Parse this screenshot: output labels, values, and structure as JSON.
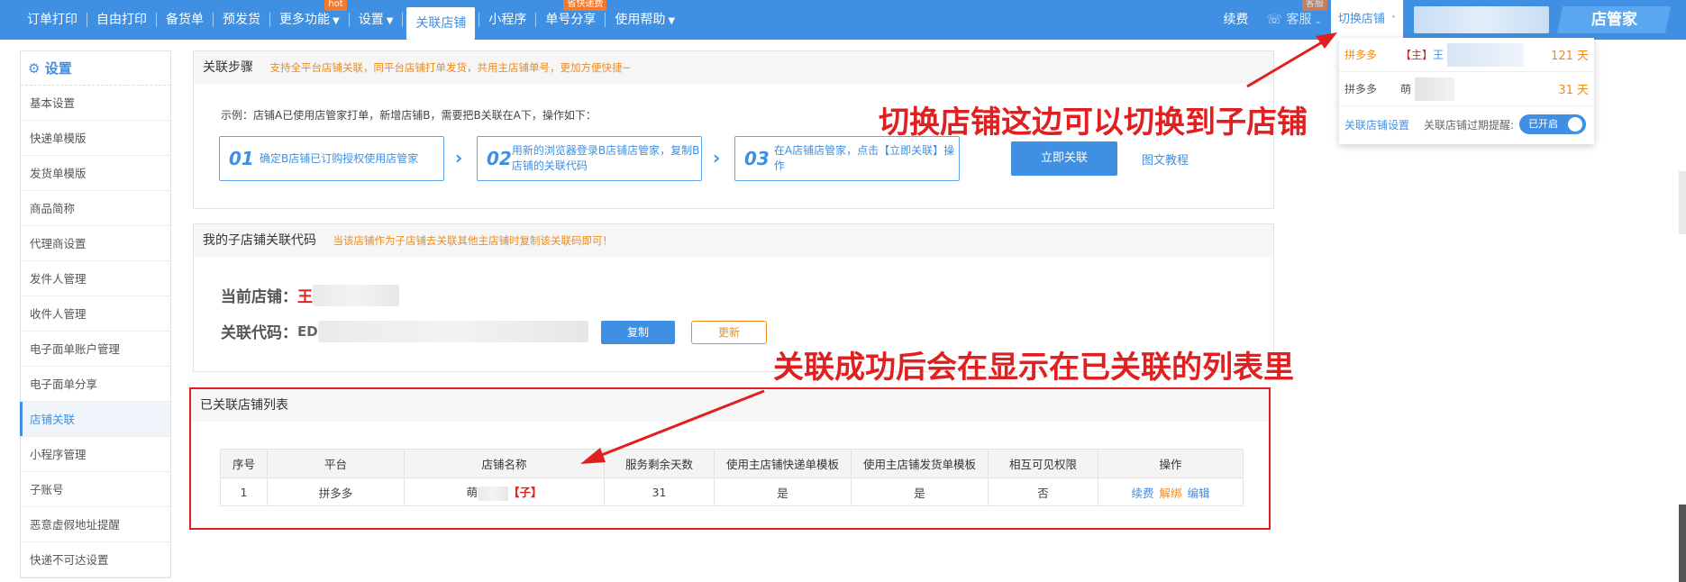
{
  "topnav": {
    "items": [
      {
        "label": "订单打印"
      },
      {
        "label": "自由打印"
      },
      {
        "label": "备货单"
      },
      {
        "label": "预发货"
      },
      {
        "label": "更多功能",
        "badge": "hot"
      },
      {
        "label": "设置"
      },
      {
        "label": "关联店铺"
      },
      {
        "label": "小程序"
      },
      {
        "label": "单号分享",
        "badge": "省快递费"
      },
      {
        "label": "使用帮助"
      }
    ],
    "right": {
      "renew": "续费",
      "service": "客服",
      "service_badge": "客服",
      "switch_store": "切换店铺",
      "brand": "店管家"
    }
  },
  "sidebar": {
    "title": "设置",
    "items": [
      "基本设置",
      "快递单模版",
      "发货单模版",
      "商品简称",
      "代理商设置",
      "发件人管理",
      "收件人管理",
      "电子面单账户管理",
      "电子面单分享",
      "店铺关联",
      "小程序管理",
      "子账号",
      "恶意虚假地址提醒",
      "快递不可达设置"
    ],
    "active_index": 9
  },
  "steps_panel": {
    "title": "关联步骤",
    "hint": "支持全平台店铺关联，同平台店铺打单发货，共用主店铺单号，更加方便快捷~",
    "example": "示例：店铺A已使用店管家打单，新增店铺B，需要把B关联在A下，操作如下：",
    "steps": [
      {
        "num": "01",
        "text": "确定B店铺已订购授权使用店管家"
      },
      {
        "num": "02",
        "text": "用新的浏览器登录B店铺店管家，复制B店铺的关联代码"
      },
      {
        "num": "03",
        "text": "在A店铺店管家，点击【立即关联】操作"
      }
    ],
    "link_now": "立即关联",
    "tutorial": "图文教程"
  },
  "code_panel": {
    "title": "我的子店铺关联代码",
    "hint": "当该店铺作为子店铺去关联其他主店铺时复制该关联码即可！",
    "current_store_label": "当前店铺：",
    "current_store_value": "王",
    "link_code_label": "关联代码：",
    "link_code_value": "ED",
    "copy_btn": "复制",
    "update_btn": "更新"
  },
  "linked_panel": {
    "title": "已关联店铺列表",
    "columns": [
      "序号",
      "平台",
      "店铺名称",
      "服务剩余天数",
      "使用主店铺快递单模板",
      "使用主店铺发货单模板",
      "相互可见权限",
      "操作"
    ],
    "rows": [
      {
        "index": "1",
        "platform": "拼多多",
        "name": "萌",
        "tag": "【子】",
        "days": "31",
        "express_tpl": "是",
        "ship_tpl": "是",
        "visible": "否",
        "ops": {
          "renew": "续费",
          "unbind": "解绑",
          "edit": "编辑"
        }
      }
    ]
  },
  "dropdown": {
    "rows": [
      {
        "platform": "拼多多",
        "tag": "【主】",
        "name": "王",
        "days": "121 天"
      },
      {
        "platform": "拼多多",
        "tag": "",
        "name": "萌",
        "days": "31 天"
      }
    ],
    "settings": "关联店铺设置",
    "remind": "关联店铺过期提醒:",
    "toggle": "已开启"
  },
  "annotations": {
    "switch_note": "切换店铺这边可以切换到子店铺",
    "list_note": "关联成功后会在显示在已关联的列表里",
    "color": "#e02020"
  }
}
